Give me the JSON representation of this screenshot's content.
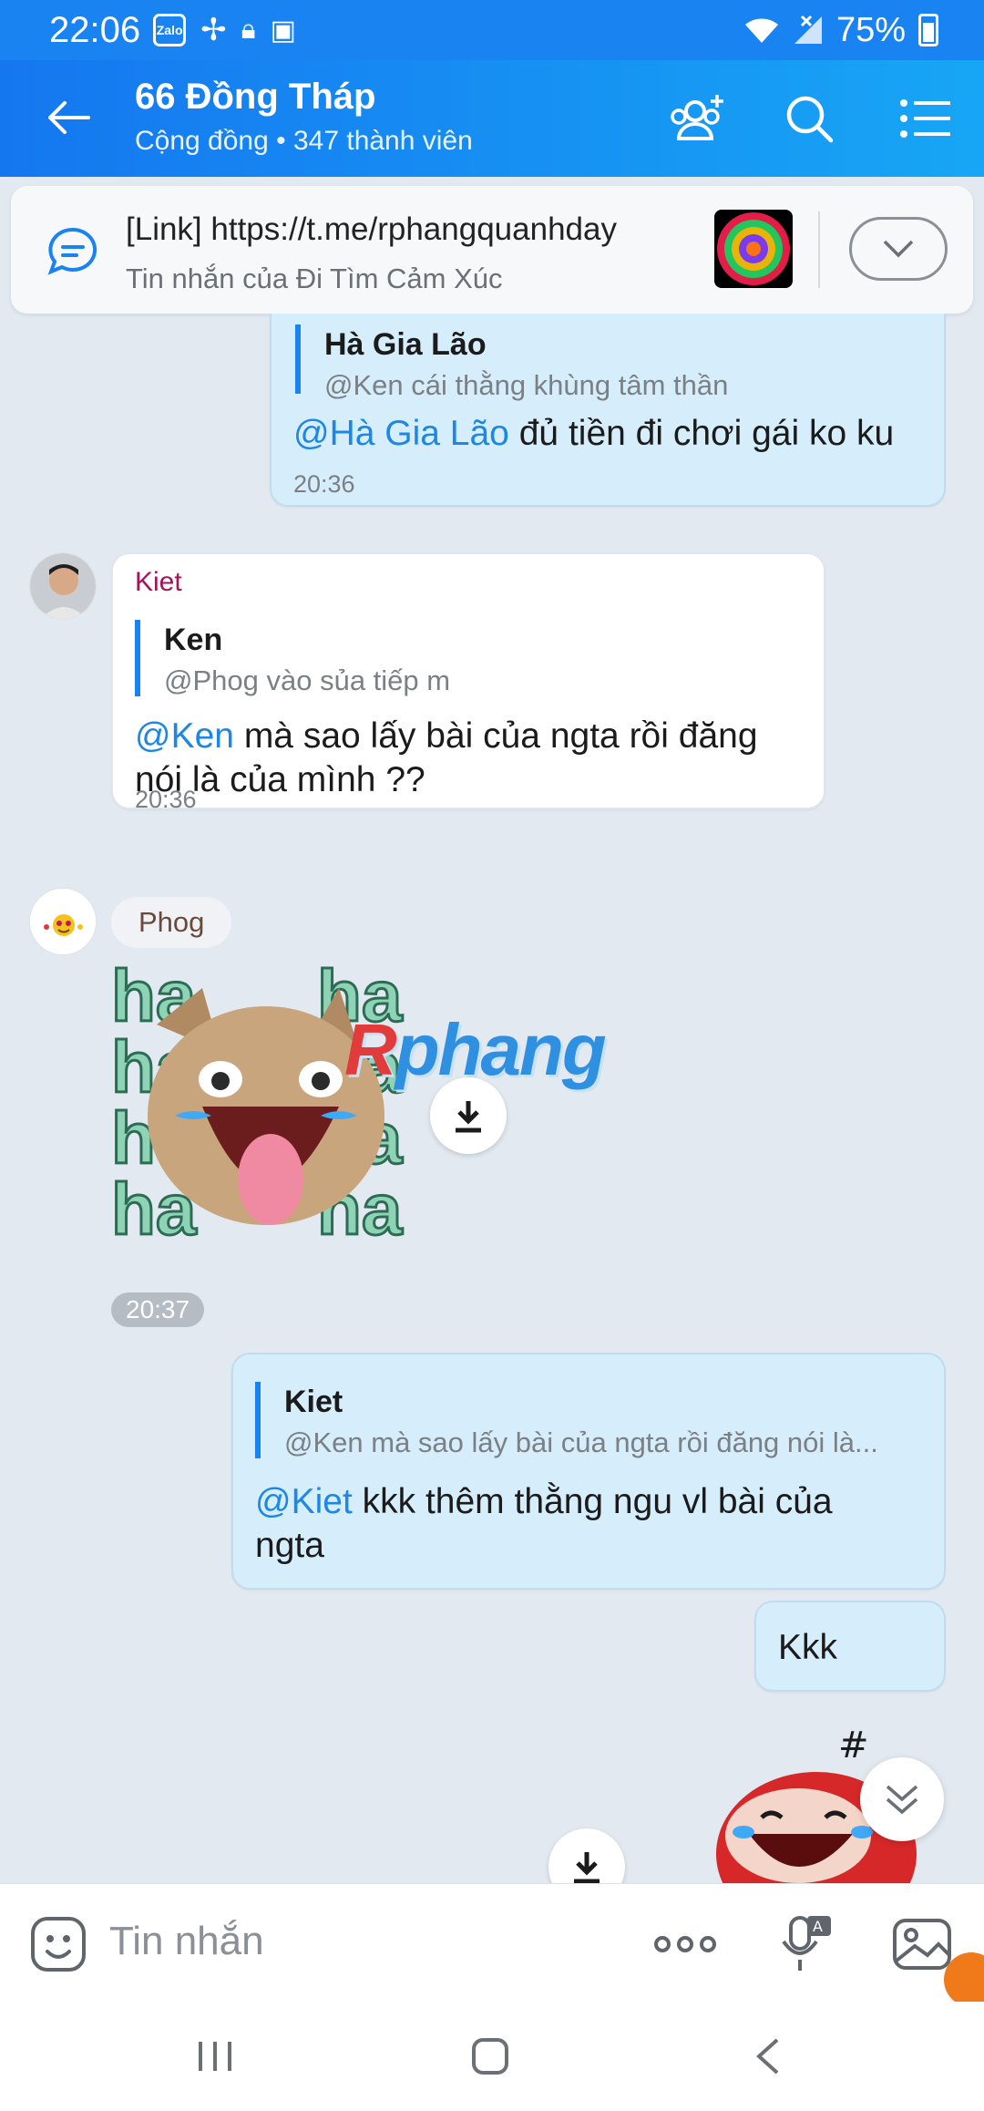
{
  "status_bar": {
    "time": "22:06",
    "battery": "75%",
    "app_badge": "Zalo"
  },
  "header": {
    "title": "66 Đồng Tháp",
    "subtitle": "Cộng đồng • 347 thành viên"
  },
  "pinned": {
    "title": "[Link] https://t.me/rphangquanhday",
    "subtitle": "Tin nhắn của Đi Tìm Cảm Xúc"
  },
  "messages": [
    {
      "direction": "out",
      "quote_name": "Hà Gia Lão",
      "quote_text": "@Ken cái thằng khùng tâm thần",
      "mention": "@Hà Gia Lão",
      "text": " đủ tiền đi chơi gái ko ku",
      "time": "20:36"
    },
    {
      "direction": "in",
      "sender": "Kiet",
      "quote_name": "Ken",
      "quote_text": "@Phog  vào sủa tiếp m",
      "mention": "@Ken",
      "text": " mà sao lấy bài của ngta rồi đăng nói là của mình ??",
      "time": "20:36"
    },
    {
      "direction": "in",
      "sender": "Phog",
      "type": "sticker",
      "sticker_text": "ha",
      "time": "20:37"
    },
    {
      "direction": "out",
      "quote_name": "Kiet",
      "quote_text": "@Ken mà sao lấy bài của ngta rồi đăng nói là...",
      "mention": "@Kiet",
      "text": " kkk thêm thằng ngu vl bài của ngta"
    },
    {
      "direction": "out",
      "text": "Kkk"
    },
    {
      "direction": "out",
      "type": "sticker"
    }
  ],
  "watermark": {
    "first": "R",
    "rest": "phang"
  },
  "composer": {
    "placeholder": "Tin nhắn"
  },
  "colors": {
    "header_start": "#1577f0",
    "header_end": "#17a6f5",
    "out_bubble": "#d6edfc",
    "mention": "#1c88e4",
    "sender": "#a4135a"
  }
}
